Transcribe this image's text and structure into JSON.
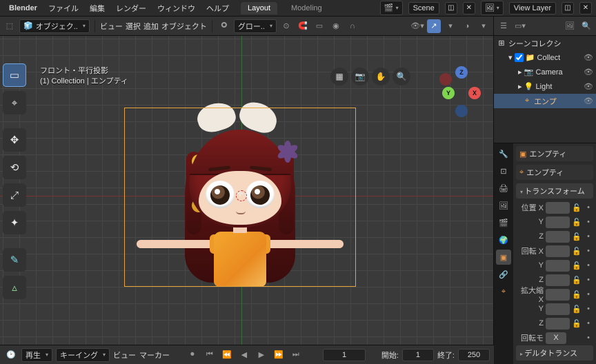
{
  "header": {
    "brand": "Blender",
    "menus": [
      "ファイル",
      "編集",
      "レンダー",
      "ウィンドウ",
      "ヘルプ"
    ],
    "workspaces": {
      "active": "Layout",
      "others": [
        "Modeling"
      ]
    },
    "scene_label": "Scene",
    "layer_label": "View Layer"
  },
  "viewport_header": {
    "mode": "オブジェク..",
    "menus": [
      "ビュー",
      "選択",
      "追加",
      "オブジェクト"
    ],
    "orientation": "グロー.."
  },
  "overlay": {
    "line1": "フロント・平行投影",
    "line2": "(1) Collection | エンプティ"
  },
  "gizmo_axes": {
    "x": "X",
    "y": "Y",
    "z": "Z"
  },
  "outliner": {
    "root": "シーンコレクシ",
    "items": [
      {
        "name": "Collect",
        "icon": "�집",
        "sel": false,
        "color": "#e0e0e0"
      },
      {
        "name": "Camera",
        "icon": "📷",
        "sel": false,
        "color": "#e0e0e0"
      },
      {
        "name": "Light",
        "icon": "💡",
        "sel": false,
        "color": "#e0e0e0"
      },
      {
        "name": "エンプ",
        "icon": "⌖",
        "sel": true,
        "color": "#f0a444"
      }
    ],
    "collection_icon": "⊞"
  },
  "properties": {
    "crumb_icon": "⌖",
    "crumb": "エンプティ",
    "name_field": "エンプティ",
    "panels": {
      "transform": "トランスフォーム",
      "location": "位置",
      "rotation": "回転",
      "scale": "拡大縮",
      "rotmode_label": "回転モ",
      "rotmode_value": "X",
      "delta": "デルタトランス"
    },
    "axes": [
      "X",
      "Y",
      "Z"
    ]
  },
  "timeline": {
    "play_menu": "再生",
    "keying_menu": "キーイング",
    "menus": [
      "ビュー",
      "マーカー"
    ],
    "current": "1",
    "start_label": "開始:",
    "start": "1",
    "end_label": "終了:",
    "end": "250"
  },
  "icons": {
    "cursor": "⌖",
    "grid": "▦",
    "cam": "📷",
    "hand": "✋",
    "zoom": "🔍",
    "search": "🔍",
    "eye": "👁",
    "link": "🔗",
    "magnet": "🧲",
    "overlap": "◑",
    "arrow": "↔",
    "circles": "⦾",
    "wrench": "🔧",
    "sphere": "🌐",
    "world": "🌍",
    "image": "🖼",
    "display": "🖥",
    "dotsq": "⊡"
  }
}
